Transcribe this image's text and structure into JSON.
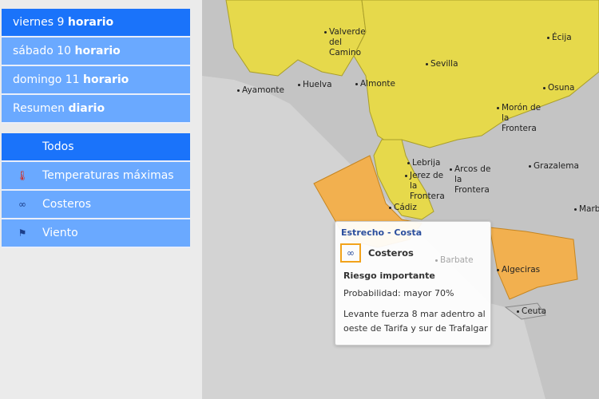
{
  "days": [
    {
      "pre": "viernes 9",
      "bold": "horario",
      "active": true
    },
    {
      "pre": "sábado 10",
      "bold": "horario"
    },
    {
      "pre": "domingo 11",
      "bold": "horario"
    },
    {
      "pre": "Resumen",
      "bold": "diario"
    }
  ],
  "types": [
    {
      "label": "Todos",
      "icon": "",
      "active": true
    },
    {
      "label": "Temperaturas máximas",
      "icon": "thermometer-icon"
    },
    {
      "label": "Costeros",
      "icon": "coastal-wave-icon"
    },
    {
      "label": "Viento",
      "icon": "wind-flag-icon"
    }
  ],
  "colors": {
    "active": "#1a73fa",
    "item": "#6aa9ff",
    "yellow": "#e6d94b",
    "orange": "#f2b04f"
  },
  "places": [
    "Valverde del Camino",
    "Écija",
    "Sevilla",
    "Ayamonte",
    "Huelva",
    "Almonte",
    "Osuna",
    "Morón de la Frontera",
    "Lebrija",
    "Grazalema",
    "Jerez de la Frontera",
    "Arcos de la Frontera",
    "Cádiz",
    "Marb",
    "Barbate",
    "Algeciras",
    "Ceuta"
  ],
  "tooltip": {
    "zone": "Estrecho - Costa",
    "type": "Costeros",
    "risk": "Riesgo importante",
    "probability": "Probabilidad: mayor 70%",
    "description": "Levante fuerza 8 mar adentro al oeste de Tarifa y sur de Trafalgar"
  }
}
